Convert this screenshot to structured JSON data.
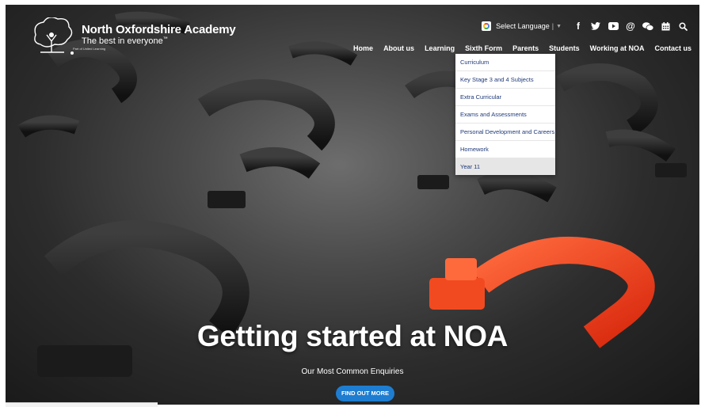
{
  "brand": {
    "name": "North Oxfordshire Academy",
    "tagline": "The best in everyone",
    "tagline_mark": "™",
    "part_of": "Part of United Learning"
  },
  "topbar": {
    "language_label": "Select Language",
    "language_separator": "|",
    "icons": [
      {
        "name": "facebook-icon",
        "glyph": "f"
      },
      {
        "name": "twitter-icon",
        "glyph": "🐦"
      },
      {
        "name": "youtube-icon",
        "glyph": "▶"
      },
      {
        "name": "email-icon",
        "glyph": "@"
      },
      {
        "name": "chat-icon",
        "glyph": "💬"
      },
      {
        "name": "calendar-icon",
        "glyph": "▦"
      },
      {
        "name": "search-icon",
        "glyph": "🔍"
      }
    ]
  },
  "nav": {
    "items": [
      "Home",
      "About us",
      "Learning",
      "Sixth Form",
      "Parents",
      "Students",
      "Working at NOA",
      "Contact us"
    ]
  },
  "dropdown": {
    "parent": "Learning",
    "items": [
      "Curriculum",
      "Key Stage 3 and 4 Subjects",
      "Extra Curricular",
      "Exams and Assessments",
      "Personal Development and Careers",
      "Homework",
      "Year 11"
    ],
    "active": "Year 11"
  },
  "hero": {
    "title": "Getting started at NOA",
    "subtitle": "Our Most Common Enquiries",
    "cta": "FIND OUT MORE"
  },
  "colors": {
    "accent": "#1e7dd0",
    "dropdown_text": "#1f3a7a",
    "highlight_mark": "#ff4a24"
  }
}
